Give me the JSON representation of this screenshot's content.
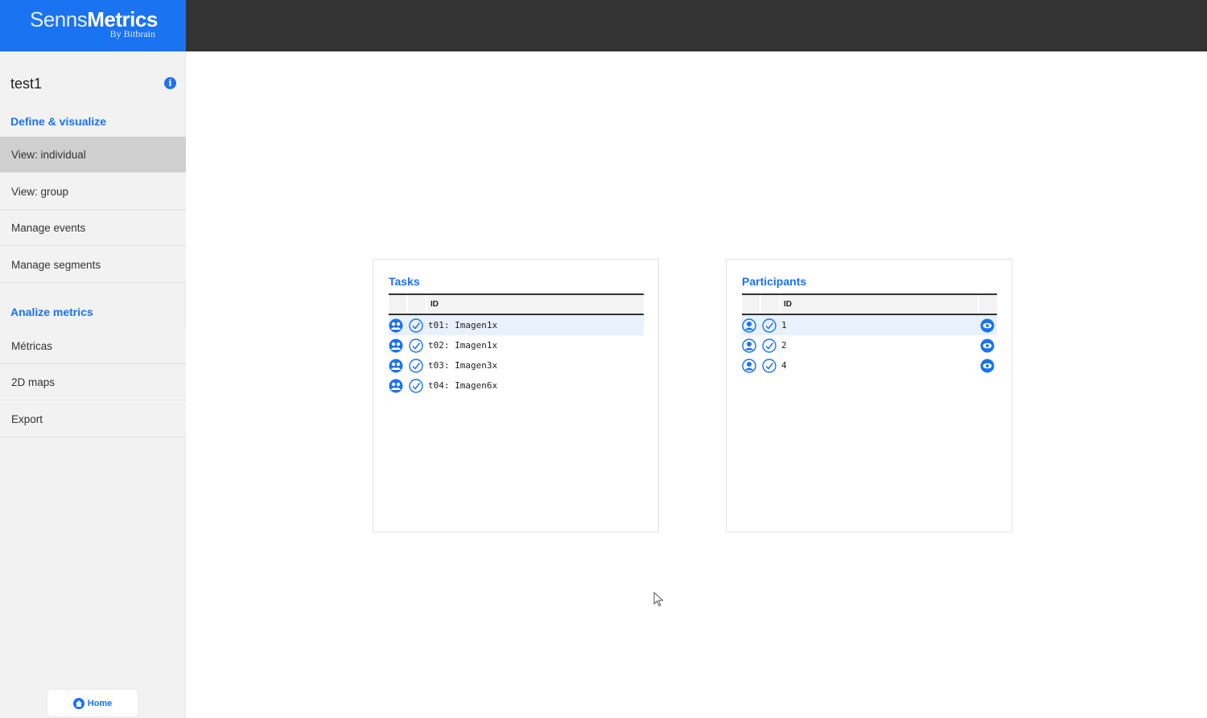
{
  "app": {
    "logo_light": "Senns",
    "logo_bold": "Metrics",
    "logo_sub": "By Bitbrain"
  },
  "sidebar": {
    "project_name": "test1",
    "info_icon": "info-icon",
    "section_define": "Define & visualize",
    "define_items": [
      {
        "label": "View: individual",
        "active": true
      },
      {
        "label": "View: group",
        "active": false
      },
      {
        "label": "Manage events",
        "active": false
      },
      {
        "label": "Manage segments",
        "active": false
      }
    ],
    "section_analize": "Analize metrics",
    "analize_items": [
      {
        "label": "Métricas"
      },
      {
        "label": "2D maps"
      },
      {
        "label": "Export"
      }
    ],
    "home_label": "Home"
  },
  "tasks": {
    "title": "Tasks",
    "col_id": "ID",
    "rows": [
      {
        "label": "t01: Imagen1x",
        "selected": true
      },
      {
        "label": "t02: Imagen1x",
        "selected": false
      },
      {
        "label": "t03: Imagen3x",
        "selected": false
      },
      {
        "label": "t04: Imagen6x",
        "selected": false
      }
    ]
  },
  "participants": {
    "title": "Participants",
    "col_id": "ID",
    "rows": [
      {
        "label": "1",
        "selected": true
      },
      {
        "label": "2",
        "selected": false
      },
      {
        "label": "4",
        "selected": false
      }
    ]
  },
  "colors": {
    "brand_blue": "#1a73f0",
    "topbar": "#333333",
    "sidebar_bg": "#f2f2f2",
    "active_item": "#cfcfcf",
    "row_highlight": "#e8f1fc"
  }
}
